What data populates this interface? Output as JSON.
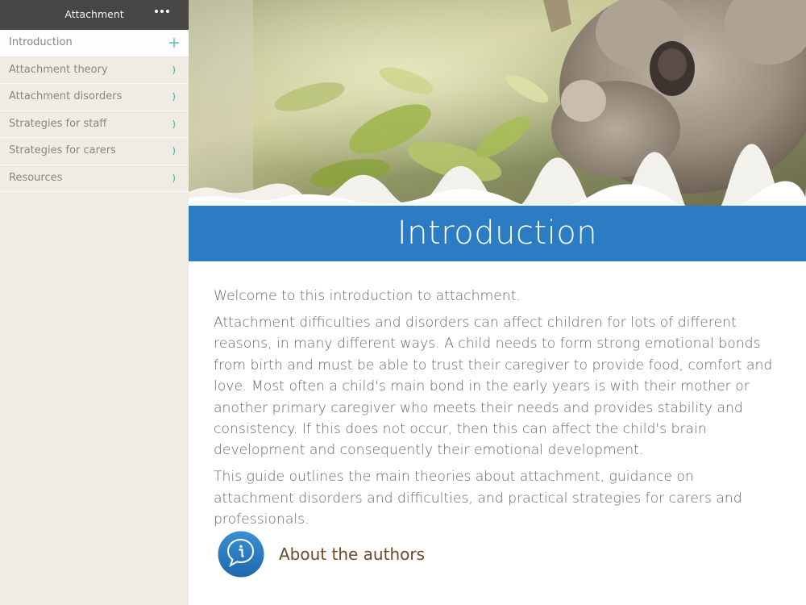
{
  "sidebar": {
    "title": "Attachment",
    "more_icon": "more-dots-icon",
    "items": [
      {
        "label": "Introduction",
        "icon": "plus-icon",
        "active": true
      },
      {
        "label": "Attachment theory",
        "icon": "chevron-right-icon"
      },
      {
        "label": "Attachment disorders",
        "icon": "chevron-right-icon"
      },
      {
        "label": "Strategies for staff",
        "icon": "chevron-right-icon"
      },
      {
        "label": "Strategies for carers",
        "icon": "chevron-right-icon"
      },
      {
        "label": "Resources",
        "icon": "chevron-right-icon"
      }
    ]
  },
  "page": {
    "title": "Introduction",
    "paragraphs": [
      "Welcome to this introduction to attachment.",
      "Attachment difficulties and disorders can affect children for lots of different reasons, in many different ways. A child needs to form strong emotional bonds from birth and must be able to trust their caregiver to provide food, comfort and love. Most often a child's main bond in the early years is with their mother or another primary caregiver who meets their needs and provides stability and consistency. If this does not occur, then this can affect the child's brain development and consequently their emotional development.",
      "This guide outlines the main theories about attachment, guidance on attachment disorders and difficulties, and practical strategies for carers and professionals."
    ],
    "authors_link": "About the authors",
    "authors_icon": "info-speech-bubble-icon",
    "hero_image": "koala-mother-and-joey-photo"
  },
  "colors": {
    "header_dark": "#474644",
    "sidebar_bg": "#efece3",
    "accent_blue": "#2b7cc2",
    "teal_icon": "#5bbcb4",
    "body_text": "#6a6661",
    "link_brown": "#6b4a26"
  }
}
